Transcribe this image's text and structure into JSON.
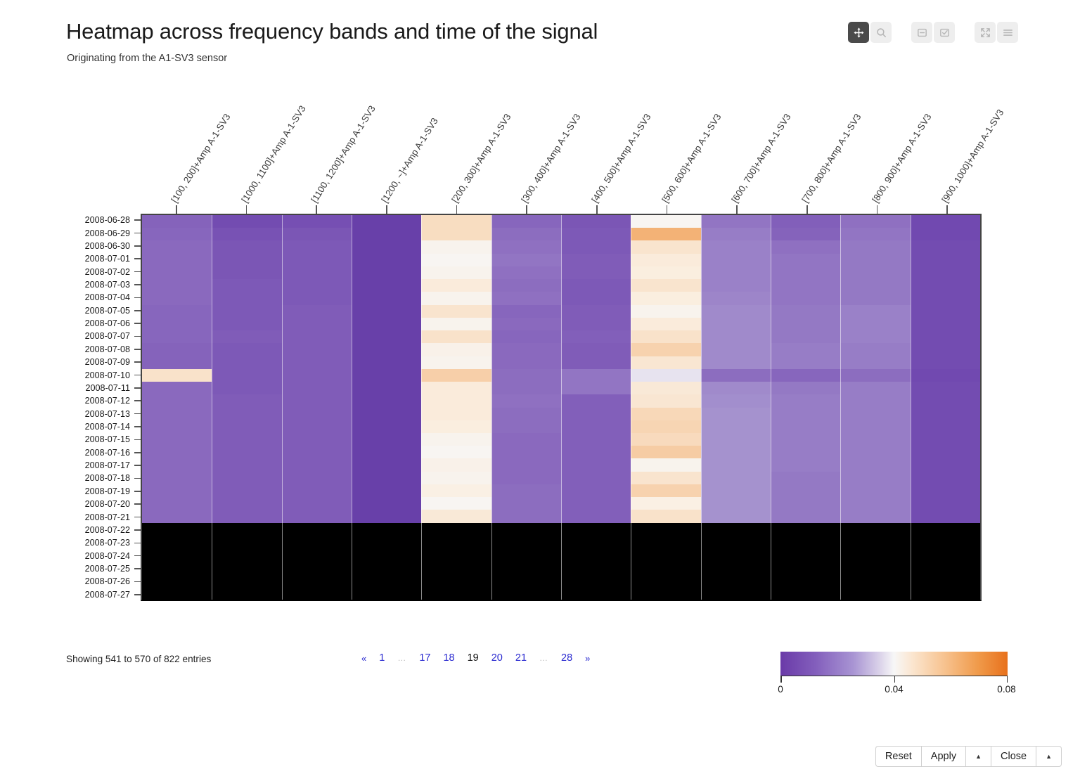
{
  "header": {
    "title": "Heatmap across frequency bands and time of the signal",
    "subtitle": "Originating from the A1-SV3 sensor"
  },
  "toolbar": {
    "items": [
      {
        "name": "pan-icon",
        "label": "Pan",
        "active": true
      },
      {
        "name": "zoom-search-icon",
        "label": "Zoom",
        "active": false
      },
      {
        "name": "box-select-icon",
        "label": "Box Select",
        "active": false
      },
      {
        "name": "checkbox-select-icon",
        "label": "Select",
        "active": false
      },
      {
        "name": "fullscreen-icon",
        "label": "Fullscreen",
        "active": false
      },
      {
        "name": "menu-icon",
        "label": "Menu",
        "active": false
      }
    ]
  },
  "footer": {
    "showing": "Showing 541 to 570 of 822 entries",
    "pagination": [
      {
        "label": "«",
        "kind": "arrow"
      },
      {
        "label": "1",
        "kind": "page"
      },
      {
        "label": "…",
        "kind": "ellipsis"
      },
      {
        "label": "17",
        "kind": "page"
      },
      {
        "label": "18",
        "kind": "page"
      },
      {
        "label": "19",
        "kind": "current"
      },
      {
        "label": "20",
        "kind": "page"
      },
      {
        "label": "21",
        "kind": "page"
      },
      {
        "label": "…",
        "kind": "ellipsis"
      },
      {
        "label": "28",
        "kind": "page"
      },
      {
        "label": "»",
        "kind": "arrow"
      }
    ]
  },
  "bottom_bar": {
    "buttons": [
      {
        "label": "Reset",
        "name": "reset-button"
      },
      {
        "label": "Apply",
        "name": "apply-button"
      },
      {
        "label": "▲",
        "name": "apply-caret-button"
      },
      {
        "label": "Close",
        "name": "close-button"
      },
      {
        "label": "▲",
        "name": "close-caret-button"
      }
    ]
  },
  "chart_data": {
    "type": "heatmap",
    "title": "Heatmap across frequency bands and time of the signal",
    "subtitle": "Originating from the A1-SV3 sensor",
    "xlabel": "",
    "ylabel": "",
    "grid": false,
    "colormap": "PuOr",
    "colorbar": {
      "min": 0,
      "max": 0.08,
      "ticks": [
        0,
        0.04,
        0.08
      ],
      "tick_labels": [
        "0",
        "0.04",
        "0.08"
      ],
      "position": "bottom-right",
      "low_color": "#6a3aa8",
      "mid_color": "#f7f7f7",
      "high_color": "#e8711c"
    },
    "missing_color": "#000000",
    "categories": [
      "[100, 200]+Amp A-1-SV3",
      "[1000, 1100]+Amp A-1-SV3",
      "[1100, 1200]+Amp A-1-SV3",
      "[1200, ~]+Amp A-1-SV3",
      "[200, 300]+Amp A-1-SV3",
      "[300, 400]+Amp A-1-SV3",
      "[400, 500]+Amp A-1-SV3",
      "[500, 600]+Amp A-1-SV3",
      "[600, 700]+Amp A-1-SV3",
      "[700, 800]+Amp A-1-SV3",
      "[800, 900]+Amp A-1-SV3",
      "[900, 1000]+Amp A-1-SV3"
    ],
    "y": [
      "2008-06-28",
      "2008-06-29",
      "2008-06-30",
      "2008-07-01",
      "2008-07-02",
      "2008-07-03",
      "2008-07-04",
      "2008-07-05",
      "2008-07-06",
      "2008-07-07",
      "2008-07-08",
      "2008-07-09",
      "2008-07-10",
      "2008-07-11",
      "2008-07-12",
      "2008-07-13",
      "2008-07-14",
      "2008-07-15",
      "2008-07-16",
      "2008-07-17",
      "2008-07-18",
      "2008-07-19",
      "2008-07-20",
      "2008-07-21",
      "2008-07-22",
      "2008-07-23",
      "2008-07-24",
      "2008-07-25",
      "2008-07-26",
      "2008-07-27"
    ],
    "values": [
      [
        0.019,
        0.012,
        0.013,
        0.006,
        0.052,
        0.02,
        0.015,
        0.041,
        0.024,
        0.018,
        0.023,
        0.011
      ],
      [
        0.02,
        0.014,
        0.015,
        0.006,
        0.052,
        0.022,
        0.016,
        0.066,
        0.026,
        0.019,
        0.024,
        0.011
      ],
      [
        0.021,
        0.015,
        0.016,
        0.006,
        0.042,
        0.023,
        0.016,
        0.049,
        0.027,
        0.023,
        0.025,
        0.012
      ],
      [
        0.021,
        0.015,
        0.016,
        0.006,
        0.041,
        0.024,
        0.017,
        0.046,
        0.027,
        0.024,
        0.025,
        0.012
      ],
      [
        0.021,
        0.015,
        0.016,
        0.006,
        0.042,
        0.023,
        0.017,
        0.045,
        0.027,
        0.024,
        0.025,
        0.012
      ],
      [
        0.021,
        0.016,
        0.016,
        0.006,
        0.046,
        0.022,
        0.016,
        0.049,
        0.027,
        0.024,
        0.025,
        0.012
      ],
      [
        0.021,
        0.016,
        0.016,
        0.006,
        0.042,
        0.023,
        0.016,
        0.045,
        0.028,
        0.024,
        0.025,
        0.012
      ],
      [
        0.02,
        0.016,
        0.017,
        0.006,
        0.049,
        0.02,
        0.017,
        0.042,
        0.029,
        0.025,
        0.027,
        0.012
      ],
      [
        0.02,
        0.016,
        0.017,
        0.006,
        0.042,
        0.021,
        0.017,
        0.046,
        0.029,
        0.025,
        0.027,
        0.012
      ],
      [
        0.02,
        0.017,
        0.017,
        0.006,
        0.05,
        0.02,
        0.018,
        0.05,
        0.029,
        0.025,
        0.027,
        0.012
      ],
      [
        0.019,
        0.016,
        0.017,
        0.006,
        0.043,
        0.021,
        0.017,
        0.056,
        0.029,
        0.026,
        0.026,
        0.012
      ],
      [
        0.019,
        0.016,
        0.017,
        0.006,
        0.042,
        0.021,
        0.017,
        0.048,
        0.029,
        0.026,
        0.026,
        0.012
      ],
      [
        0.05,
        0.016,
        0.017,
        0.006,
        0.057,
        0.022,
        0.024,
        0.039,
        0.022,
        0.02,
        0.022,
        0.011
      ],
      [
        0.021,
        0.016,
        0.017,
        0.006,
        0.046,
        0.022,
        0.024,
        0.047,
        0.029,
        0.025,
        0.026,
        0.012
      ],
      [
        0.021,
        0.017,
        0.017,
        0.006,
        0.046,
        0.023,
        0.018,
        0.048,
        0.03,
        0.026,
        0.026,
        0.012
      ],
      [
        0.021,
        0.017,
        0.017,
        0.006,
        0.046,
        0.022,
        0.018,
        0.054,
        0.031,
        0.026,
        0.026,
        0.012
      ],
      [
        0.021,
        0.017,
        0.017,
        0.006,
        0.045,
        0.022,
        0.018,
        0.055,
        0.031,
        0.026,
        0.026,
        0.012
      ],
      [
        0.021,
        0.017,
        0.017,
        0.006,
        0.042,
        0.021,
        0.018,
        0.053,
        0.031,
        0.026,
        0.026,
        0.012
      ],
      [
        0.021,
        0.017,
        0.017,
        0.006,
        0.041,
        0.021,
        0.018,
        0.058,
        0.031,
        0.026,
        0.026,
        0.012
      ],
      [
        0.021,
        0.017,
        0.017,
        0.006,
        0.043,
        0.021,
        0.018,
        0.042,
        0.031,
        0.026,
        0.026,
        0.012
      ],
      [
        0.021,
        0.017,
        0.017,
        0.006,
        0.042,
        0.021,
        0.018,
        0.049,
        0.031,
        0.025,
        0.026,
        0.012
      ],
      [
        0.021,
        0.017,
        0.017,
        0.006,
        0.044,
        0.022,
        0.018,
        0.056,
        0.031,
        0.025,
        0.026,
        0.012
      ],
      [
        0.021,
        0.017,
        0.017,
        0.006,
        0.041,
        0.022,
        0.018,
        0.044,
        0.031,
        0.025,
        0.026,
        0.012
      ],
      [
        0.021,
        0.017,
        0.017,
        0.006,
        0.047,
        0.022,
        0.018,
        0.05,
        0.031,
        0.025,
        0.026,
        0.012
      ],
      [
        null,
        null,
        null,
        null,
        null,
        null,
        null,
        null,
        null,
        null,
        null,
        null
      ],
      [
        null,
        null,
        null,
        null,
        null,
        null,
        null,
        null,
        null,
        null,
        null,
        null
      ],
      [
        null,
        null,
        null,
        null,
        null,
        null,
        null,
        null,
        null,
        null,
        null,
        null
      ],
      [
        null,
        null,
        null,
        null,
        null,
        null,
        null,
        null,
        null,
        null,
        null,
        null
      ],
      [
        null,
        null,
        null,
        null,
        null,
        null,
        null,
        null,
        null,
        null,
        null,
        null
      ],
      [
        null,
        null,
        null,
        null,
        null,
        null,
        null,
        null,
        null,
        null,
        null,
        null
      ]
    ]
  }
}
